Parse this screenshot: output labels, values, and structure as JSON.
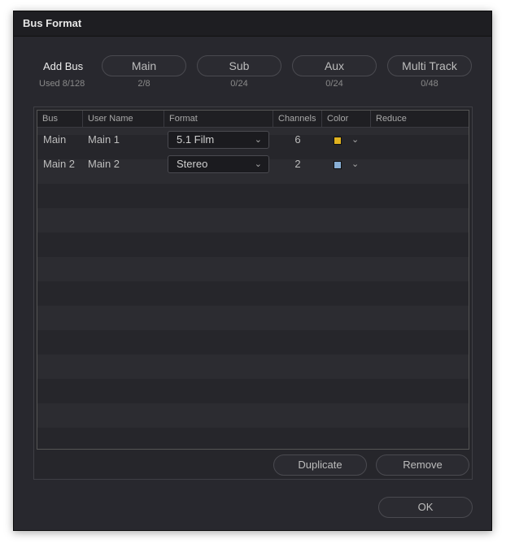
{
  "dialog": {
    "title": "Bus Format"
  },
  "add_bus": {
    "label": "Add Bus",
    "used": "Used 8/128",
    "types": [
      {
        "label": "Main",
        "count": "2/8"
      },
      {
        "label": "Sub",
        "count": "0/24"
      },
      {
        "label": "Aux",
        "count": "0/24"
      },
      {
        "label": "Multi Track",
        "count": "0/48"
      }
    ]
  },
  "table": {
    "columns": [
      "Bus",
      "User Name",
      "Format",
      "Channels",
      "Color",
      "Reduce"
    ],
    "rows": [
      {
        "bus": "Main",
        "user_name": "Main 1",
        "format": "5.1 Film",
        "channels": "6",
        "color": "#e0b21f"
      },
      {
        "bus": "Main 2",
        "user_name": "Main 2",
        "format": "Stereo",
        "channels": "2",
        "color": "#88aed4"
      }
    ]
  },
  "actions": {
    "duplicate": "Duplicate",
    "remove": "Remove",
    "ok": "OK"
  },
  "icons": {
    "chevron": "chevron-down-icon"
  }
}
